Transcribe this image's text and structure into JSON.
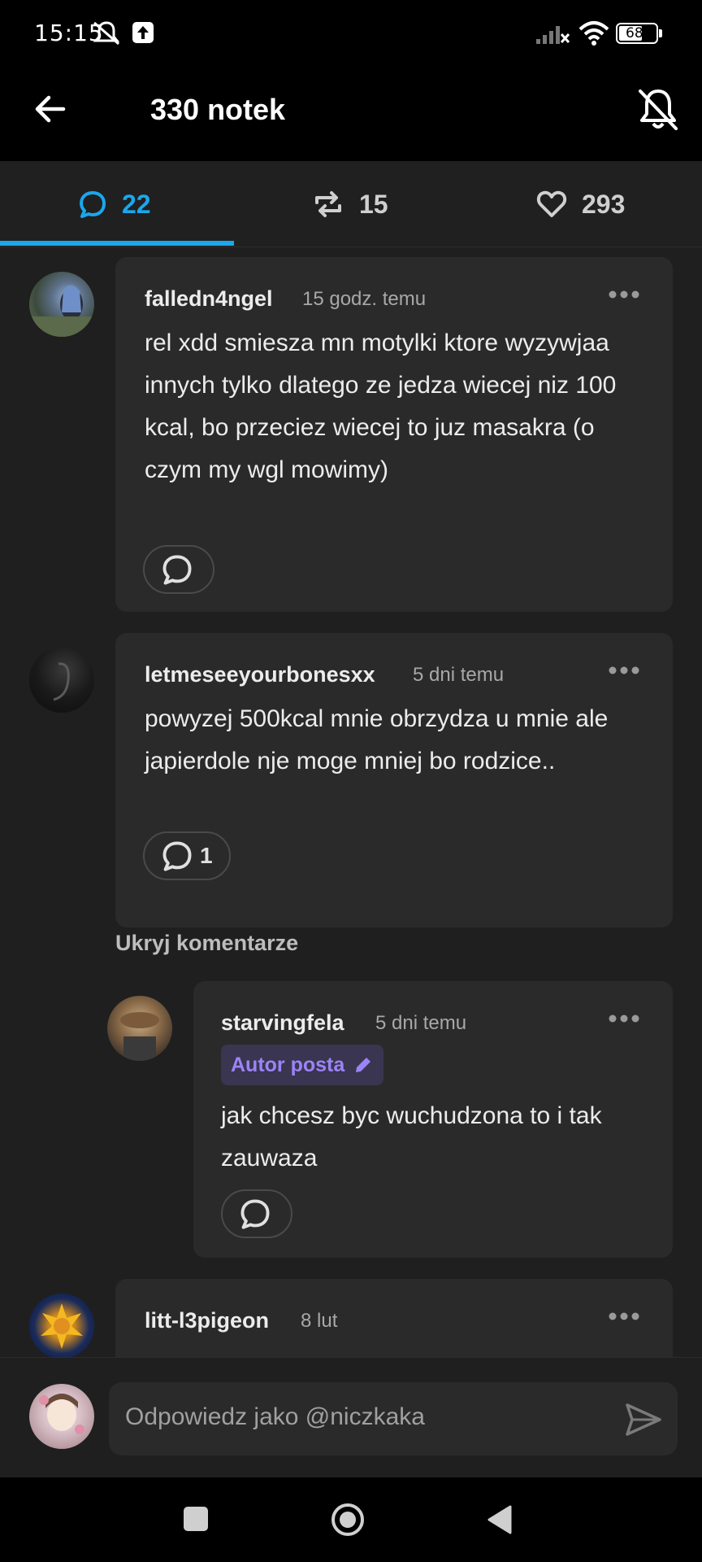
{
  "status_bar": {
    "time": "15:15",
    "battery": "68",
    "icons": [
      "mute-icon",
      "upload-icon",
      "signal-icon",
      "wifi-icon",
      "battery-icon"
    ]
  },
  "header": {
    "title": "330 notek",
    "back_icon": "arrow-left-icon",
    "notify_icon": "bell-off-icon"
  },
  "tabs": [
    {
      "icon": "comment-icon",
      "count": "22",
      "active": true
    },
    {
      "icon": "reblog-icon",
      "count": "15",
      "active": false
    },
    {
      "icon": "heart-icon",
      "count": "293",
      "active": false
    }
  ],
  "comments": [
    {
      "user": "falledn4ngel",
      "time": "15 godz. temu",
      "text": "rel xdd smiesza mn motylki ktore wyzywjaa innych tylko dlatego ze jedza wiecej niz 100 kcal, bo przeciez wiecej to juz masakra (o czym my wgl mowimy)",
      "replies": ""
    },
    {
      "user": "letmeseeyourbonesxx",
      "time": "5 dni temu",
      "text": "powyzej 500kcal mnie obrzydza u mnie ale japierdole nje moge mniej bo rodzice..",
      "replies": "1"
    },
    {
      "user": "starvingfela",
      "time": "5 dni temu",
      "badge": "Autor posta",
      "text": "jak chcesz byc wuchudzona to i tak zauwaza",
      "replies": ""
    },
    {
      "user": "litt-l3pigeon",
      "time": "8 lut",
      "text": ""
    }
  ],
  "hide_comments_label": "Ukryj komentarze",
  "reply_bar": {
    "placeholder": "Odpowiedz jako @niczkaka",
    "send_icon": "send-icon"
  },
  "nav_bar": {
    "icons": [
      "recents-square-icon",
      "home-circle-icon",
      "back-triangle-icon"
    ]
  },
  "colors": {
    "accent": "#1aa7ec",
    "card": "#2a2a2a",
    "background": "#1f1f1f",
    "badge_text": "#9b84f5"
  }
}
